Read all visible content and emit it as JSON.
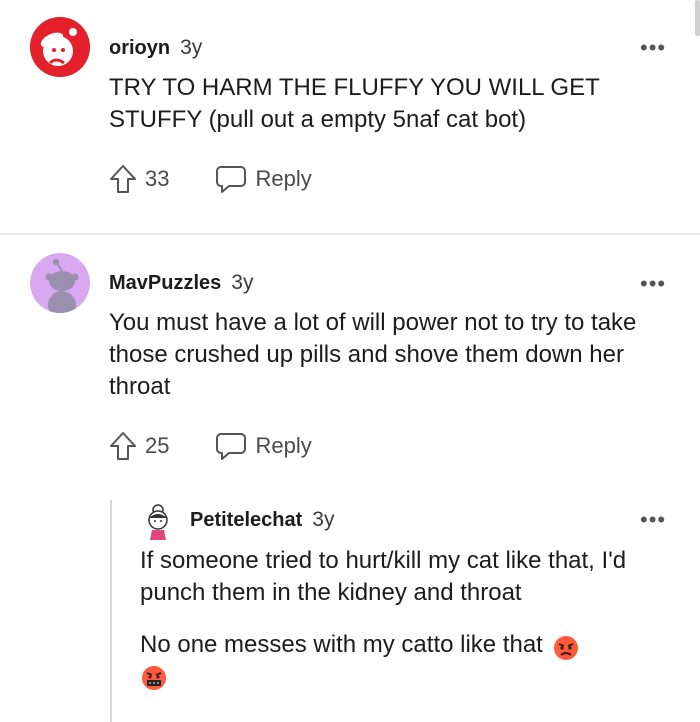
{
  "comments": [
    {
      "author": "orioyn",
      "age": "3y",
      "body": "TRY TO HARM THE FLUFFY YOU WILL GET STUFFY (pull out a empty 5naf cat bot)",
      "upvotes": "33",
      "reply_label": "Reply",
      "more_label": "•••"
    },
    {
      "author": "MavPuzzles",
      "age": "3y",
      "body": "You must have a lot of will power not to try to take those crushed up pills and shove them down her throat",
      "upvotes": "25",
      "reply_label": "Reply",
      "more_label": "•••"
    },
    {
      "author": "Petitelechat",
      "age": "3y",
      "body": "If someone tried to hurt/kill my cat like that, I'd punch them in the kidney and throat",
      "body2": "No one messes with my catto like that",
      "more_label": "•••"
    }
  ],
  "colors": {
    "orioyn_avatar_bg": "#e4202a",
    "mavpuzzles_avatar_bg": "#d9a8f0",
    "mavpuzzles_snoo": "#9b8fb0",
    "petitelechat_outfit": "#e0457b",
    "angry_emoji": "#ff5a3c"
  },
  "icons": [
    "upvote-icon",
    "reply-icon",
    "more-options-icon",
    "angry-face-emoji",
    "cursing-face-emoji"
  ]
}
